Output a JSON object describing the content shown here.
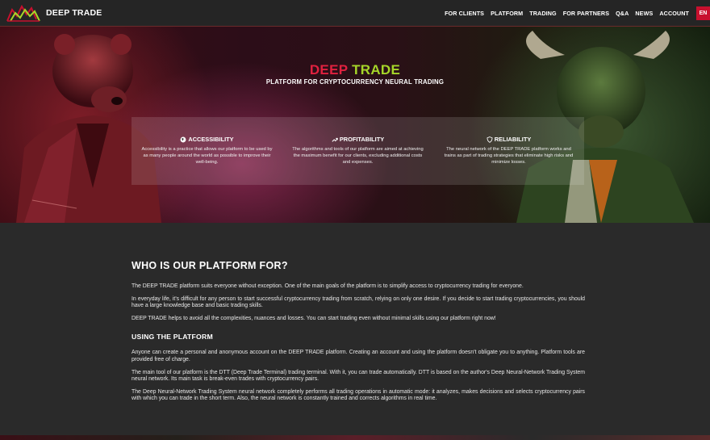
{
  "header": {
    "brand": "DEEP TRADE",
    "nav": [
      "FOR CLIENTS",
      "PLATFORM",
      "TRADING",
      "FOR PARTNERS",
      "Q&A",
      "NEWS",
      "ACCOUNT"
    ],
    "lang": "EN"
  },
  "hero": {
    "title_part1": "DEEP",
    "title_part2": "TRADE",
    "subtitle": "PLATFORM FOR CRYPTOCURRENCY NEURAL TRADING",
    "features": [
      {
        "icon": "globe-icon",
        "title": "ACCESSIBILITY",
        "text": "Accessibility is a practice that allows our platform to be used by as many people around the world as possible to improve their well-being."
      },
      {
        "icon": "trend-up-icon",
        "title": "PROFITABILITY",
        "text": "The algorithms and tools of our platform are aimed at achieving the maximum benefit for our clients, excluding additional costs and expenses."
      },
      {
        "icon": "shield-icon",
        "title": "RELIABILITY",
        "text": "The neural network of the DEEP TRADE platform works and trains as part of trading strategies that eliminate high risks and minimize losses."
      }
    ]
  },
  "content": {
    "heading": "WHO IS OUR PLATFORM FOR?",
    "p1": "The DEEP TRADE platform suits everyone without exception. One of the main goals of the platform is to simplify access to cryptocurrency trading for everyone.",
    "p2": "In everyday life, it's difficult for any person to start successful cryptocurrency trading from scratch, relying on only one desire. If you decide to start trading cryptocurrencies, you should have a large knowledge base and basic trading skills.",
    "p3": "DEEP TRADE helps to avoid all the complexities, nuances and losses. You can start trading even without minimal skills using our platform right now!",
    "subheading": "USING THE PLATFORM",
    "p4": "Anyone can create a personal and anonymous account on the DEEP TRADE platform. Creating an account and using the platform doesn't obligate you to anything. Platform tools are provided free of charge.",
    "p5": "The main tool of our platform is the DTT (Deep Trade Terminal) trading terminal. With it, you can trade automatically. DTT is based on the author's Deep Neural-Network Trading System neural network. Its main task is break-even trades with cryptocurrency pairs.",
    "p6": "The Deep Neural-Network Trading System neural network completely performs all trading operations in automatic mode: it analyzes, makes decisions and selects cryptocurrency pairs with which you can trade in the short term. Also, the neural network is constantly trained and corrects algorithms in real time."
  },
  "colors": {
    "deep": "#e0213f",
    "trade": "#a6d629",
    "lang_bg": "#c8102e"
  }
}
